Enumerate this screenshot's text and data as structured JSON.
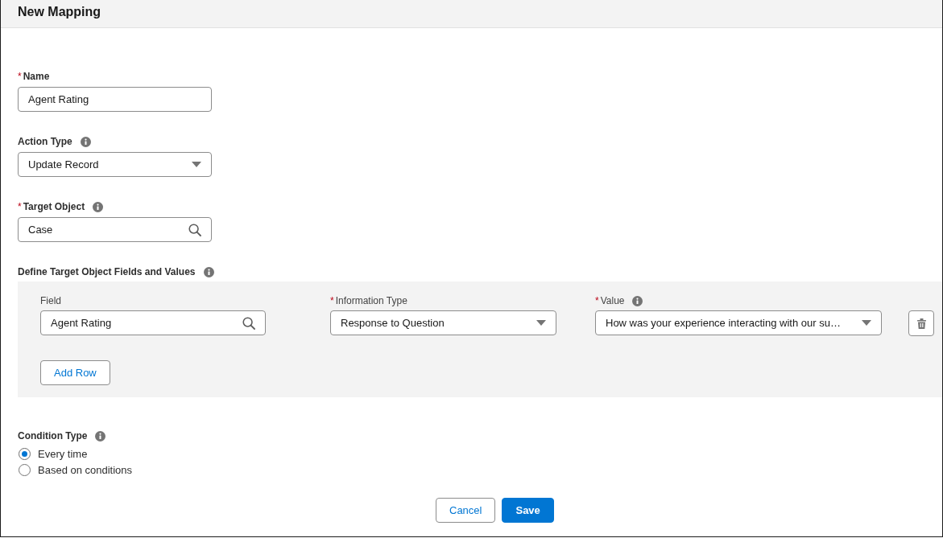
{
  "dialog": {
    "title": "New Mapping"
  },
  "fields": [
    {
      "kind": "text",
      "label": "Name",
      "required_mark": "*",
      "info": false,
      "value": "Agent Rating"
    },
    {
      "kind": "select",
      "label": "Action Type",
      "info": true,
      "value": "Update Record"
    },
    {
      "kind": "lookup",
      "label": "Target Object",
      "required_mark": "*",
      "info": true,
      "value": "Case"
    }
  ],
  "field_values": {
    "label": "Define Target Object Fields and Values",
    "info": true,
    "columns": [
      {
        "label": "Field",
        "info": false
      },
      {
        "label": "Information Type",
        "required_mark": "*",
        "info": false
      },
      {
        "label": "Value",
        "required_mark": "*",
        "info": true
      }
    ],
    "rows": [
      {
        "cells": [
          {
            "kind": "lookup",
            "value": "Agent Rating"
          },
          {
            "kind": "select",
            "value": "Response to Question"
          },
          {
            "kind": "select",
            "value": "How was your experience interacting with our su…"
          }
        ]
      }
    ],
    "add_button": "Add Row"
  },
  "condition_type": {
    "label": "Condition Type",
    "info": true,
    "options": [
      {
        "label": "Every time",
        "selected": true
      },
      {
        "label": "Based on conditions",
        "selected": false
      }
    ]
  },
  "footer": {
    "buttons": [
      {
        "kind": "neutral",
        "label": "Cancel"
      },
      {
        "kind": "brand",
        "label": "Save"
      }
    ]
  }
}
